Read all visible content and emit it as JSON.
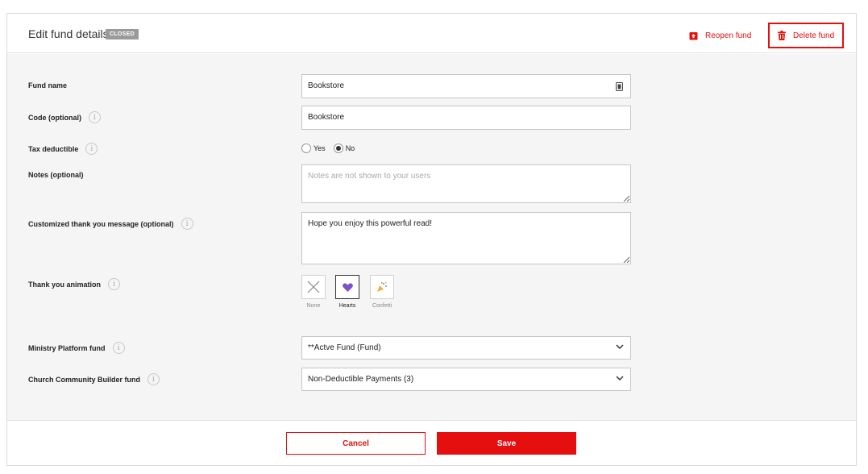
{
  "header": {
    "title": "Edit fund details",
    "status_badge": "CLOSED",
    "reopen_label": "Reopen fund",
    "delete_label": "Delete fund"
  },
  "form": {
    "fund_name": {
      "label": "Fund name",
      "value": "Bookstore"
    },
    "code": {
      "label": "Code (optional)",
      "value": "Bookstore"
    },
    "tax_deductible": {
      "label": "Tax deductible",
      "options": [
        "Yes",
        "No"
      ],
      "selected": "No"
    },
    "notes": {
      "label": "Notes (optional)",
      "placeholder": "Notes are not shown to your users",
      "value": ""
    },
    "thank_you_message": {
      "label": "Customized thank you message (optional)",
      "value": "Hope you enjoy this powerful read!"
    },
    "thank_you_animation": {
      "label": "Thank you animation",
      "options": [
        {
          "label": "None",
          "icon": "x-icon"
        },
        {
          "label": "Hearts",
          "icon": "heart-icon"
        },
        {
          "label": "Confetti",
          "icon": "confetti-icon"
        }
      ],
      "selected": "Hearts"
    },
    "ministry_platform_fund": {
      "label": "Ministry Platform fund",
      "value": "**Actve Fund (Fund)"
    },
    "ccb_fund": {
      "label": "Church Community Builder fund",
      "value": "Non-Deductible Payments (3)"
    }
  },
  "footer": {
    "cancel_label": "Cancel",
    "save_label": "Save"
  },
  "colors": {
    "accent": "#e60f0f",
    "heart": "#7b52c9",
    "background": "#f5f5f5",
    "badge": "#9a9a9a"
  }
}
